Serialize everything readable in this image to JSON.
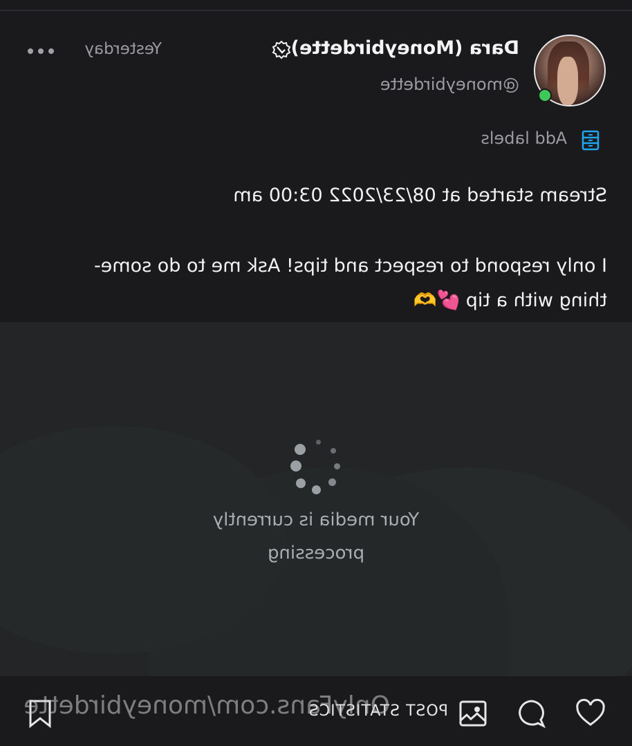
{
  "post": {
    "author_name": "Dara (Moneybirdette)",
    "author_handle": "@moneybirdette",
    "timestamp": "Yesterday",
    "online": true,
    "labels_action": "Add labels",
    "text_line1": "Stream started at 08/23/2022 03:00 am",
    "text_line2": "I only respond to respect and tips! Ask me to do some-",
    "text_line3": "thing with a tip 💕🫶"
  },
  "media": {
    "status": "Your media is currently processing"
  },
  "actions": {
    "post_stats_label": "POST STATISTICS",
    "watermark": "OnlyFans.com/moneybirdette"
  },
  "icons": [
    "verified-badge-icon",
    "more-icon",
    "labels-icon",
    "spinner-icon",
    "heart-icon",
    "comment-icon",
    "media-icon",
    "bookmark-icon"
  ],
  "colors": {
    "online": "#3fc85a",
    "labels_icon": "#1ea7f0",
    "background": "#1a1a1c",
    "media_bg": "#232526"
  }
}
